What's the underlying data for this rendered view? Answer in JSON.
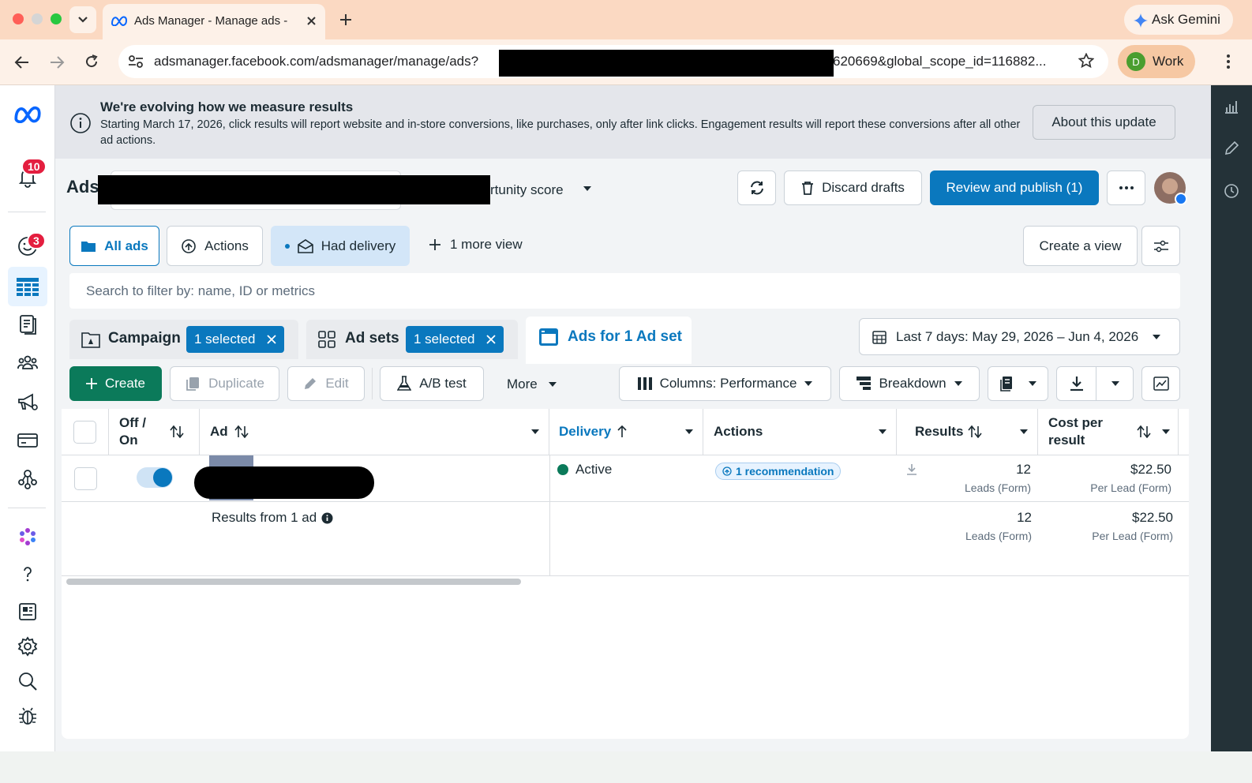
{
  "browser": {
    "tab_title": "Ads Manager - Manage ads -",
    "url_start": "adsmanager.facebook.com/adsmanager/manage/ads?",
    "url_end": "620669&global_scope_id=116882...",
    "profile_initial": "D",
    "profile_name": "Work",
    "gemini_label": "Ask Gemini"
  },
  "nav": {
    "notifications_count": "10",
    "messages_count": "3"
  },
  "banner": {
    "title": "We're evolving how we measure results",
    "body": "Starting March 17, 2026, click results will report website and in-store conversions, like purchases, only after link clicks. Engagement results will report these conversions after all other ad actions.",
    "button": "About this update"
  },
  "header": {
    "title": "Ads",
    "opportunity_label": "rtunity score",
    "discard_label": "Discard drafts",
    "publish_label": "Review and publish (1)"
  },
  "views": {
    "all_ads": "All ads",
    "actions": "Actions",
    "had_delivery": "Had delivery",
    "more_view": "1 more view",
    "create_view": "Create a view"
  },
  "search": {
    "placeholder": "Search to filter by: name, ID or metrics"
  },
  "levels": {
    "campaign_label": "Campaign",
    "campaign_selected": "1 selected",
    "adsets_label": "Ad sets",
    "adsets_selected": "1 selected",
    "ads_label": "Ads for 1 Ad set",
    "date_range": "Last 7 days: May 29, 2026 – Jun 4, 2026"
  },
  "toolbar": {
    "create": "Create",
    "duplicate": "Duplicate",
    "edit": "Edit",
    "ab_test": "A/B test",
    "more": "More",
    "columns": "Columns: Performance",
    "breakdown": "Breakdown"
  },
  "table": {
    "columns": {
      "off_on": "Off / On",
      "ad": "Ad",
      "delivery": "Delivery",
      "actions": "Actions",
      "results": "Results",
      "cost": "Cost per result"
    },
    "row": {
      "delivery": "Active",
      "recommendation": "1 recommendation",
      "results": "12",
      "results_sub": "Leads (Form)",
      "cost": "$22.50",
      "cost_sub": "Per Lead (Form)"
    },
    "summary": {
      "label": "Results from 1 ad",
      "results": "12",
      "results_sub": "Leads (Form)",
      "cost": "$22.50",
      "cost_sub": "Per Lead (Form)"
    }
  },
  "colors": {
    "primary": "#0a78be",
    "create": "#0b7a5a",
    "active_dot": "#0b7a5a"
  }
}
